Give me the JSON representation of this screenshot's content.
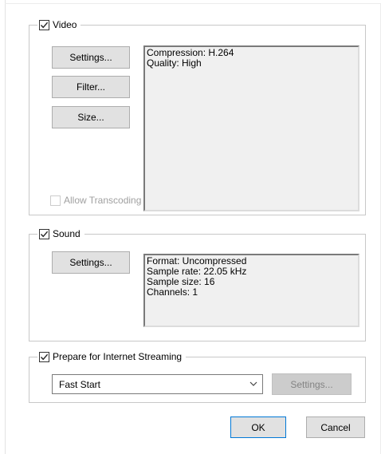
{
  "video": {
    "label": "Video",
    "checked": true,
    "buttons": {
      "settings": "Settings...",
      "filter": "Filter...",
      "size": "Size..."
    },
    "info": [
      "Compression: H.264",
      "Quality: High"
    ],
    "allow_transcoding": {
      "label": "Allow Transcoding",
      "checked": false,
      "disabled": true
    }
  },
  "sound": {
    "label": "Sound",
    "checked": true,
    "buttons": {
      "settings": "Settings..."
    },
    "info": [
      "Format: Uncompressed",
      "Sample rate: 22.05 kHz",
      "Sample size: 16",
      "Channels: 1"
    ]
  },
  "streaming": {
    "label": "Prepare for Internet Streaming",
    "checked": true,
    "selected": "Fast Start",
    "settings_label": "Settings...",
    "settings_disabled": true
  },
  "footer": {
    "ok_label": "OK",
    "cancel_label": "Cancel"
  },
  "icons": {
    "check": "checkmark-icon",
    "dropdown": "chevron-down-icon"
  },
  "colors": {
    "button_face": "#e1e1e1",
    "default_button_border": "#0078d7",
    "panel_background": "#f0f0f0",
    "disabled_text": "#a0a0a0"
  }
}
